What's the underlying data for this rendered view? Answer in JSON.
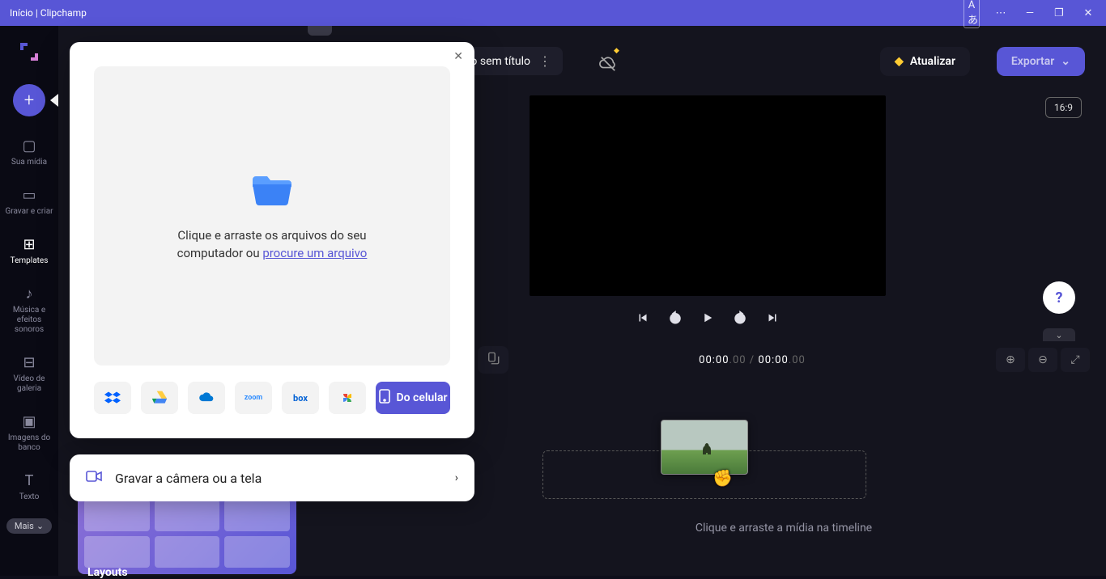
{
  "window": {
    "title": "Início | Clipchamp"
  },
  "titlebar": {
    "lang": "A"
  },
  "sidebar": {
    "items": [
      {
        "label": "Sua mídia"
      },
      {
        "label": "Gravar e criar"
      },
      {
        "label": "Templates"
      },
      {
        "label": "Música e efeitos sonoros"
      },
      {
        "label": "Vídeo de galeria"
      },
      {
        "label": "Imagens do banco"
      },
      {
        "label": "Texto"
      }
    ],
    "more": "Mais"
  },
  "project": {
    "title": "eo sem título"
  },
  "topbar": {
    "upgrade": "Atualizar",
    "export": "Exportar"
  },
  "preview": {
    "aspect": "16:9"
  },
  "time": {
    "cur_a": "00:00",
    "cur_b": ".00",
    "sep": " / ",
    "tot_a": "00:00",
    "tot_b": ".00"
  },
  "timeline": {
    "hint": "Clique e arraste a mídia na timeline"
  },
  "import_modal": {
    "drop_prefix": "Clique e arraste os arquivos do seu computador ou ",
    "browse_link": "procure um arquivo",
    "phone_btn": "Do celular",
    "providers": {
      "zoom": "zoom",
      "box": "box"
    }
  },
  "record_card": {
    "label": "Gravar a câmera ou a tela"
  },
  "layouts": {
    "label": "Layouts"
  }
}
